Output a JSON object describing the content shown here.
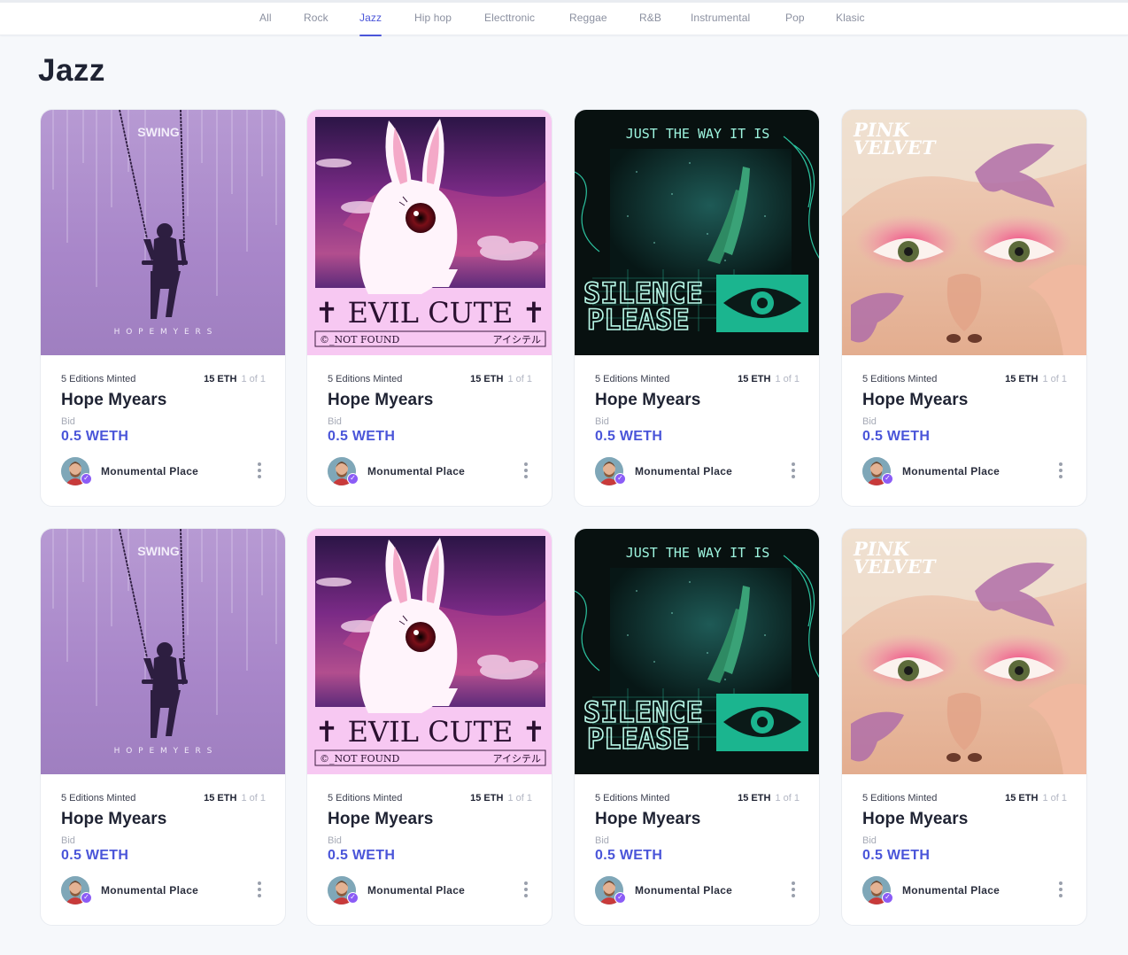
{
  "nav": {
    "tabs": [
      {
        "label": "All"
      },
      {
        "label": "Rock"
      },
      {
        "label": "Jazz",
        "active": true
      },
      {
        "label": "Hip hop"
      },
      {
        "label": "Electtronic"
      },
      {
        "label": "Reggae"
      },
      {
        "label": "R&B"
      },
      {
        "label": "Instrumental"
      },
      {
        "label": "Pop"
      },
      {
        "label": "Klasic"
      }
    ]
  },
  "page": {
    "title": "Jazz"
  },
  "artworks": {
    "swing": {
      "title": "SWING",
      "artist": "H O P E    M Y E R S"
    },
    "evil": {
      "title": "✝ EVIL CUTE ✝",
      "left_tag": "©_NOT FOUND",
      "right_tag": "アイシテル"
    },
    "silence": {
      "top": "JUST THE WAY IT IS",
      "line1": "SILENCE",
      "line2": "PLEASE"
    },
    "pink": {
      "line1": "PINK",
      "line2": "VELVET"
    }
  },
  "cards": [
    {
      "art": "swing",
      "editions": "5 Editions Minted",
      "price": "15 ETH",
      "of": "1 of 1",
      "name": "Hope Myears",
      "bid_label": "Bid",
      "bid_value": "0.5 WETH",
      "owner": "Monumental Place"
    },
    {
      "art": "evil",
      "editions": "5 Editions Minted",
      "price": "15 ETH",
      "of": "1 of 1",
      "name": "Hope Myears",
      "bid_label": "Bid",
      "bid_value": "0.5 WETH",
      "owner": "Monumental Place"
    },
    {
      "art": "silence",
      "editions": "5 Editions Minted",
      "price": "15 ETH",
      "of": "1 of 1",
      "name": "Hope Myears",
      "bid_label": "Bid",
      "bid_value": "0.5 WETH",
      "owner": "Monumental Place"
    },
    {
      "art": "pink",
      "editions": "5 Editions Minted",
      "price": "15 ETH",
      "of": "1 of 1",
      "name": "Hope Myears",
      "bid_label": "Bid",
      "bid_value": "0.5 WETH",
      "owner": "Monumental Place"
    },
    {
      "art": "swing",
      "editions": "5 Editions Minted",
      "price": "15 ETH",
      "of": "1 of 1",
      "name": "Hope Myears",
      "bid_label": "Bid",
      "bid_value": "0.5 WETH",
      "owner": "Monumental Place"
    },
    {
      "art": "evil",
      "editions": "5 Editions Minted",
      "price": "15 ETH",
      "of": "1 of 1",
      "name": "Hope Myears",
      "bid_label": "Bid",
      "bid_value": "0.5 WETH",
      "owner": "Monumental Place"
    },
    {
      "art": "silence",
      "editions": "5 Editions Minted",
      "price": "15 ETH",
      "of": "1 of 1",
      "name": "Hope Myears",
      "bid_label": "Bid",
      "bid_value": "0.5 WETH",
      "owner": "Monumental Place"
    },
    {
      "art": "pink",
      "editions": "5 Editions Minted",
      "price": "15 ETH",
      "of": "1 of 1",
      "name": "Hope Myears",
      "bid_label": "Bid",
      "bid_value": "0.5 WETH",
      "owner": "Monumental Place"
    }
  ],
  "colors": {
    "accent": "#4a55d9",
    "verified_badge": "#8b5cf6",
    "background": "#f6f8fb"
  }
}
